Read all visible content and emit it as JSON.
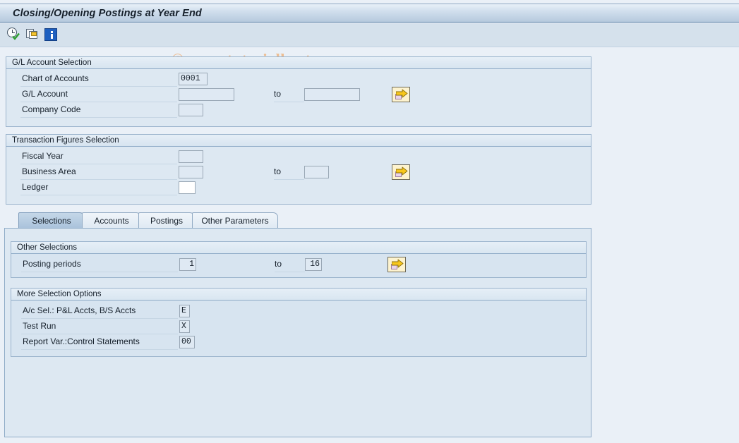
{
  "window": {
    "title": "Closing/Opening Postings at Year End"
  },
  "toolbar": {
    "icons": [
      {
        "name": "execute-icon",
        "tooltip": "Execute"
      },
      {
        "name": "multiple-selection-icon",
        "tooltip": "Get Variant"
      },
      {
        "name": "info-icon",
        "tooltip": "Information"
      }
    ]
  },
  "watermark": {
    "text": "© www.tutorialkart.com"
  },
  "gl_account_selection": {
    "title": "G/L Account Selection",
    "fields": [
      {
        "label": "Chart of Accounts",
        "value": "0001"
      },
      {
        "label": "G/L Account",
        "value": "",
        "to_label": "to",
        "to_value": ""
      },
      {
        "label": "Company Code",
        "value": ""
      }
    ],
    "multi_select_button": "multiple-selection-arrow"
  },
  "transaction_figures_selection": {
    "title": "Transaction Figures Selection",
    "fields": [
      {
        "label": "Fiscal Year",
        "value": ""
      },
      {
        "label": "Business Area",
        "value": "",
        "to_label": "to",
        "to_value": ""
      },
      {
        "label": "Ledger",
        "value": ""
      }
    ],
    "multi_select_button": "multiple-selection-arrow"
  },
  "tabs": [
    {
      "label": "Selections",
      "active": true
    },
    {
      "label": "Accounts",
      "active": false
    },
    {
      "label": "Postings",
      "active": false
    },
    {
      "label": "Other Parameters",
      "active": false
    }
  ],
  "other_selections": {
    "title": "Other Selections",
    "fields": [
      {
        "label": "Posting periods",
        "value": "1",
        "to_label": "to",
        "to_value": "16"
      }
    ],
    "multi_select_button": "multiple-selection-arrow"
  },
  "more_selection_options": {
    "title": "More Selection Options",
    "fields": [
      {
        "label": "A/c Sel.: P&L Accts, B/S Accts",
        "value": "E"
      },
      {
        "label": "Test Run",
        "value": "X"
      },
      {
        "label": "Report Var.:Control Statements",
        "value": "00"
      }
    ]
  },
  "colors": {
    "titlebar_accent": "#b8cbdf",
    "panel_bg": "#dde8f2",
    "page_bg": "#eaf0f7",
    "active_tab": "#a9c2db",
    "watermark": "#edbd92",
    "button_yellow": "#fdf3cf"
  }
}
